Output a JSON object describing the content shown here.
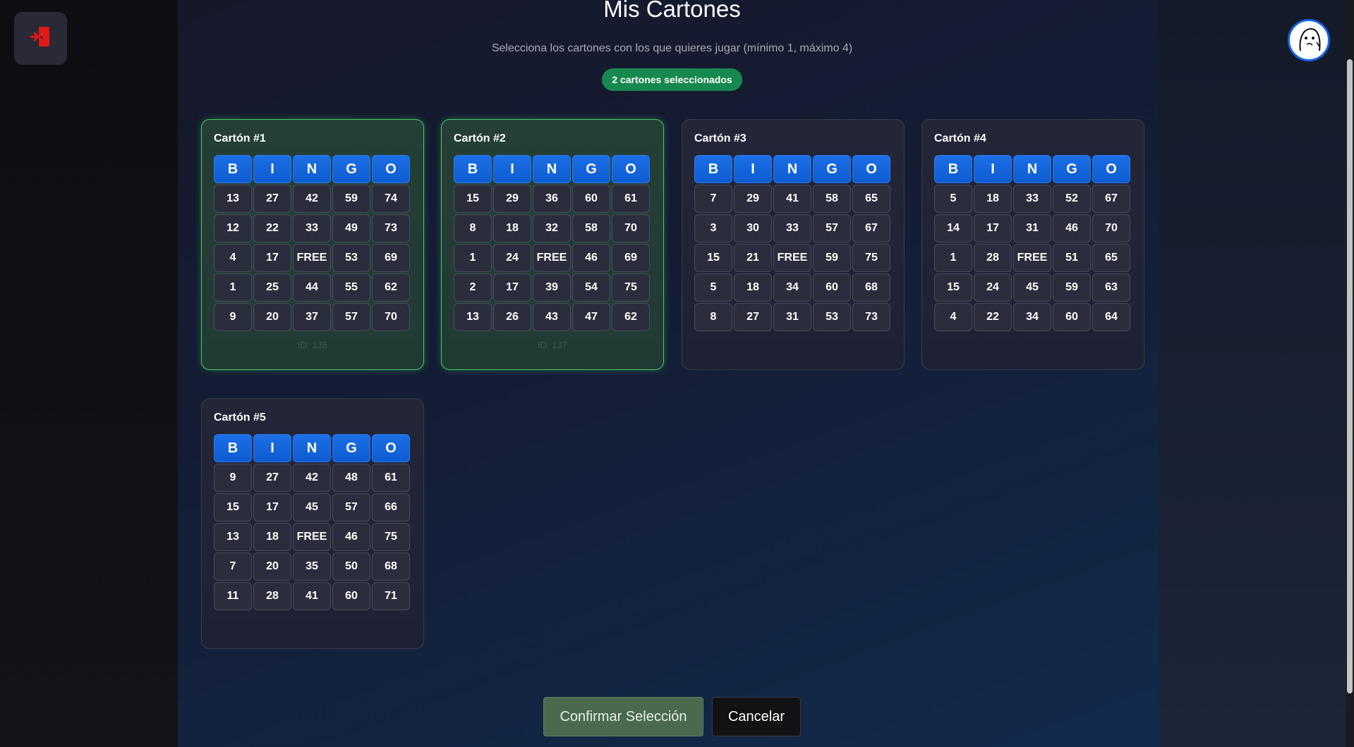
{
  "header": {
    "title": "Mis Cartones",
    "subtitle": "Selecciona los cartones con los que quieres jugar (mínimo 1, máximo 4)",
    "selected_badge": "2 cartones seleccionados"
  },
  "icons": {
    "exit": "exit-door-icon",
    "avatar": "user-avatar-icon"
  },
  "colors": {
    "accent_blue": "#1565e0",
    "selected_green": "#3fcf63",
    "badge_green": "#17884f",
    "exit_red": "#e01818"
  },
  "bingo_letters": [
    "B",
    "I",
    "N",
    "G",
    "O"
  ],
  "cards": [
    {
      "title": "Cartón #1",
      "selected": true,
      "id_label": "ID: 138",
      "rows": [
        [
          "13",
          "27",
          "42",
          "59",
          "74"
        ],
        [
          "12",
          "22",
          "33",
          "49",
          "73"
        ],
        [
          "4",
          "17",
          "FREE",
          "53",
          "69"
        ],
        [
          "1",
          "25",
          "44",
          "55",
          "62"
        ],
        [
          "9",
          "20",
          "37",
          "57",
          "70"
        ]
      ]
    },
    {
      "title": "Cartón #2",
      "selected": true,
      "id_label": "ID: 137",
      "rows": [
        [
          "15",
          "29",
          "36",
          "60",
          "61"
        ],
        [
          "8",
          "18",
          "32",
          "58",
          "70"
        ],
        [
          "1",
          "24",
          "FREE",
          "46",
          "69"
        ],
        [
          "2",
          "17",
          "39",
          "54",
          "75"
        ],
        [
          "13",
          "26",
          "43",
          "47",
          "62"
        ]
      ]
    },
    {
      "title": "Cartón #3",
      "selected": false,
      "id_label": "",
      "rows": [
        [
          "7",
          "29",
          "41",
          "58",
          "65"
        ],
        [
          "3",
          "30",
          "33",
          "57",
          "67"
        ],
        [
          "15",
          "21",
          "FREE",
          "59",
          "75"
        ],
        [
          "5",
          "18",
          "34",
          "60",
          "68"
        ],
        [
          "8",
          "27",
          "31",
          "53",
          "73"
        ]
      ]
    },
    {
      "title": "Cartón #4",
      "selected": false,
      "id_label": "",
      "rows": [
        [
          "5",
          "18",
          "33",
          "52",
          "67"
        ],
        [
          "14",
          "17",
          "31",
          "46",
          "70"
        ],
        [
          "1",
          "28",
          "FREE",
          "51",
          "65"
        ],
        [
          "15",
          "24",
          "45",
          "59",
          "63"
        ],
        [
          "4",
          "22",
          "34",
          "60",
          "64"
        ]
      ]
    },
    {
      "title": "Cartón #5",
      "selected": false,
      "id_label": "",
      "rows": [
        [
          "9",
          "27",
          "42",
          "48",
          "61"
        ],
        [
          "15",
          "17",
          "45",
          "57",
          "66"
        ],
        [
          "13",
          "18",
          "FREE",
          "46",
          "75"
        ],
        [
          "7",
          "20",
          "35",
          "50",
          "68"
        ],
        [
          "11",
          "28",
          "41",
          "60",
          "71"
        ]
      ]
    }
  ],
  "actions": {
    "confirm_label": "Confirmar Selección",
    "cancel_label": "Cancelar"
  }
}
